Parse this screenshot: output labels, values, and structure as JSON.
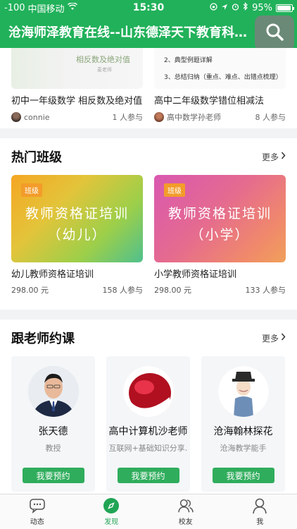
{
  "status": {
    "signal": "-100",
    "carrier": "中国移动",
    "time": "15:30",
    "battery": "95%",
    "battery_level": 0.95
  },
  "header": {
    "title": "沧海师泽教育在线--山东德泽天下教育科技..."
  },
  "top_courses": [
    {
      "thumb_title": "相反数及绝对值",
      "thumb_sub": "麦老师",
      "name": "初中一年级数学  相反数及绝对值",
      "author": "connie",
      "count": "1 人参与"
    },
    {
      "thumb_lines": [
        "2、典型例题详解",
        "3、总结归纳（重点、难点、出错点梳理）"
      ],
      "name": "高中二年级数学错位相减法",
      "author": "高中数学孙老师",
      "count": "8 人参与"
    }
  ],
  "hot_classes": {
    "title": "热门班级",
    "more": "更多",
    "items": [
      {
        "tag": "班级",
        "line1": "教师资格证培训",
        "line2": "（幼儿）",
        "name": "幼儿教师资格证培训",
        "price": "298.00 元",
        "count": "158 人参与"
      },
      {
        "tag": "班级",
        "line1": "教师资格证培训",
        "line2": "（小学）",
        "name": "小学教师资格证培训",
        "price": "298.00 元",
        "count": "133 人参与"
      }
    ]
  },
  "teachers": {
    "title": "跟老师约课",
    "more": "更多",
    "items": [
      {
        "name": "张天德",
        "desc": "教授",
        "button": "我要预约"
      },
      {
        "name": "高中计算机沙老师",
        "desc": "互联网+基础知识分享...",
        "button": "我要预约"
      },
      {
        "name": "沧海翰林探花",
        "desc": "沧海教学能手",
        "button": "我要预约"
      }
    ]
  },
  "tabbar": [
    {
      "label": "动态",
      "icon": "chat-icon"
    },
    {
      "label": "发现",
      "icon": "compass-icon"
    },
    {
      "label": "校友",
      "icon": "people-icon"
    },
    {
      "label": "我",
      "icon": "user-icon"
    }
  ],
  "colors": {
    "brand": "#21b15a",
    "button": "#2fad5c",
    "active_tab": "#21a555"
  }
}
